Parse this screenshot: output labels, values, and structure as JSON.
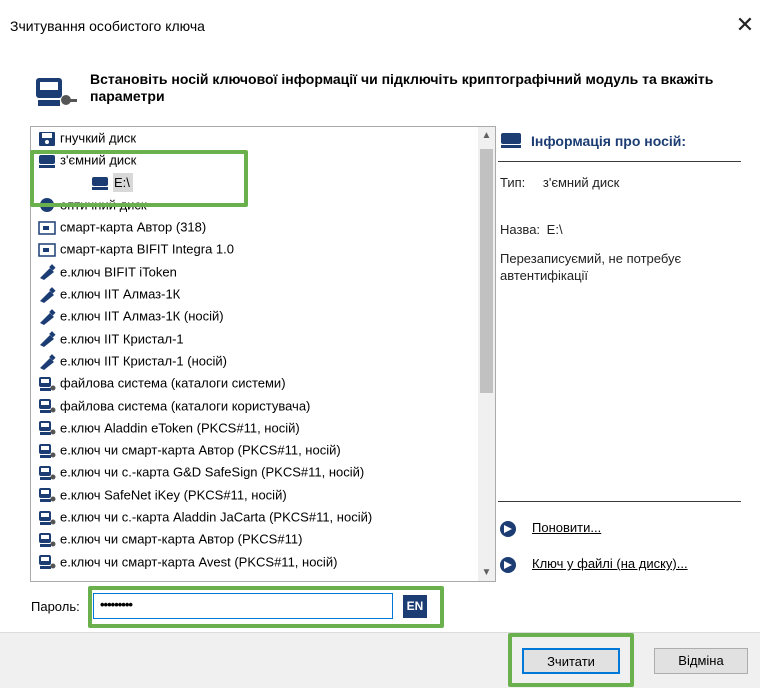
{
  "window": {
    "title": "Зчитування особистого ключа",
    "close_label": "✕"
  },
  "heading": "Встановіть носій ключової інформації чи підключіть криптографічний модуль та вкажіть параметри",
  "list": {
    "items": [
      {
        "label": "гнучкий диск",
        "icon": "floppy-disk-icon"
      },
      {
        "label": "з'ємний диск",
        "icon": "removable-disk-icon"
      },
      {
        "label": "E:\\",
        "icon": "drive-icon",
        "child": true,
        "selected": true
      },
      {
        "label": "оптичний диск",
        "icon": "optical-disk-icon"
      },
      {
        "label": "смарт-карта Автор (318)",
        "icon": "smart-card-icon"
      },
      {
        "label": "смарт-карта BIFIT Integra 1.0",
        "icon": "smart-card-icon"
      },
      {
        "label": "е.ключ BIFIT iToken",
        "icon": "usb-token-icon"
      },
      {
        "label": "е.ключ ІІТ Алмаз-1К",
        "icon": "usb-token-icon"
      },
      {
        "label": "е.ключ ІІТ Алмаз-1К (носій)",
        "icon": "usb-token-icon"
      },
      {
        "label": "е.ключ ІІТ Кристал-1",
        "icon": "usb-token-icon"
      },
      {
        "label": "е.ключ ІІТ Кристал-1 (носій)",
        "icon": "usb-token-icon"
      },
      {
        "label": "файлова система (каталоги системи)",
        "icon": "key-device-icon"
      },
      {
        "label": "файлова система (каталоги користувача)",
        "icon": "key-device-icon"
      },
      {
        "label": "е.ключ Aladdin eToken (PKCS#11, носій)",
        "icon": "key-device-icon"
      },
      {
        "label": "е.ключ чи смарт-карта Автор (PKCS#11, носій)",
        "icon": "key-device-icon"
      },
      {
        "label": "е.ключ чи с.-карта G&D SafeSign (PKCS#11, носій)",
        "icon": "key-device-icon"
      },
      {
        "label": "е.ключ SafeNet iKey (PKCS#11, носій)",
        "icon": "key-device-icon"
      },
      {
        "label": "е.ключ чи с.-карта Aladdin JaCarta (PKCS#11, носій)",
        "icon": "key-device-icon"
      },
      {
        "label": "е.ключ чи смарт-карта Автор (PKCS#11)",
        "icon": "key-device-icon"
      },
      {
        "label": "е.ключ чи смарт-карта Avest (PKCS#11, носій)",
        "icon": "key-device-icon"
      }
    ]
  },
  "info": {
    "title": "Інформація про носій:",
    "type_label": "Тип:",
    "type_value": "з'ємний диск",
    "name_label": "Назва:",
    "name_value": "E:\\",
    "description": "Перезаписуємий, не потребує автентифікації",
    "refresh_link": "Поновити...",
    "file_key_link": "Ключ у файлі (на диску)..."
  },
  "password": {
    "label": "Пароль:",
    "masked_value": "•••••••••",
    "lang": "EN"
  },
  "buttons": {
    "read": "Зчитати",
    "cancel": "Відміна"
  },
  "colors": {
    "accent": "#1c3d73",
    "highlight": "#6ab04c",
    "focus": "#0078d7"
  }
}
